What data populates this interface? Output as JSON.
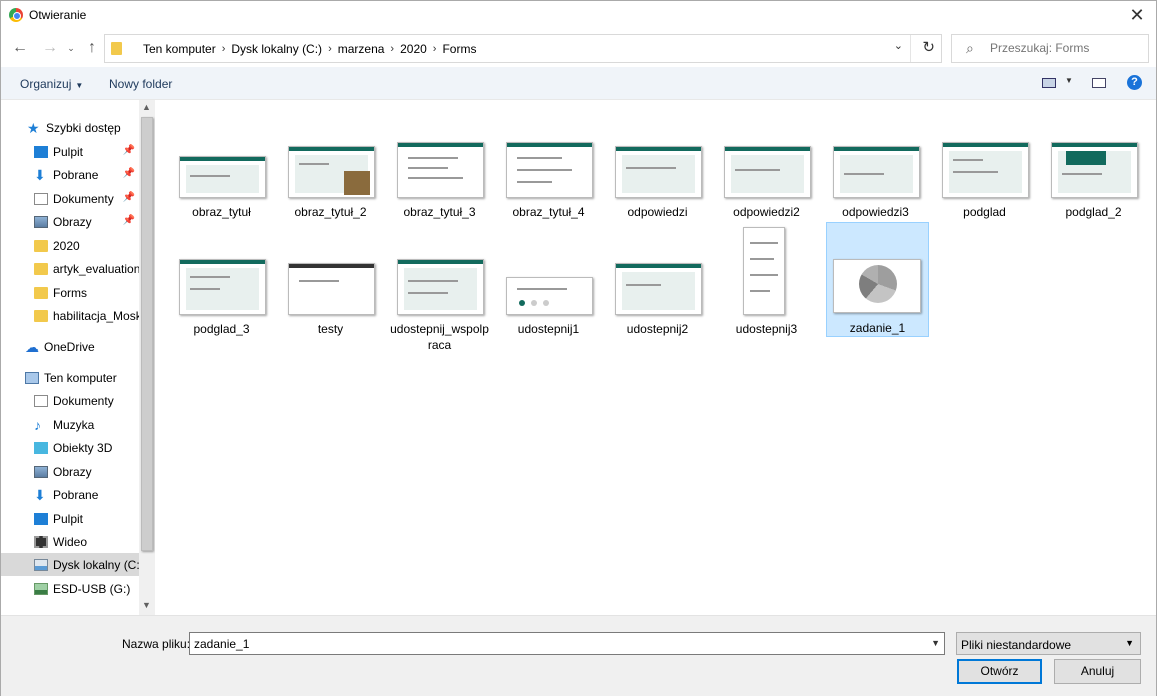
{
  "window": {
    "title": "Otwieranie"
  },
  "nav": {
    "breadcrumbs": [
      "Ten komputer",
      "Dysk lokalny (C:)",
      "marzena",
      "2020",
      "Forms"
    ],
    "search_placeholder": "Przeszukaj: Forms"
  },
  "toolbar": {
    "organize": "Organizuj",
    "new_folder": "Nowy folder"
  },
  "sidebar": {
    "items": [
      {
        "label": "Szybki dostęp",
        "icon": "star-icon"
      },
      {
        "label": "Pulpit",
        "icon": "desktop-icon",
        "pinned": true
      },
      {
        "label": "Pobrane",
        "icon": "download-icon",
        "pinned": true
      },
      {
        "label": "Dokumenty",
        "icon": "documents-icon",
        "pinned": true
      },
      {
        "label": "Obrazy",
        "icon": "pictures-icon",
        "pinned": true
      },
      {
        "label": "2020",
        "icon": "folder-icon"
      },
      {
        "label": "artyk_evaluation",
        "icon": "folder-icon"
      },
      {
        "label": "Forms",
        "icon": "folder-icon"
      },
      {
        "label": "habilitacja_Moskwa",
        "icon": "folder-icon"
      },
      {
        "label": "OneDrive",
        "icon": "cloud-icon"
      },
      {
        "label": "Ten komputer",
        "icon": "computer-icon"
      },
      {
        "label": "Dokumenty",
        "icon": "documents-icon"
      },
      {
        "label": "Muzyka",
        "icon": "music-icon"
      },
      {
        "label": "Obiekty 3D",
        "icon": "cube-icon"
      },
      {
        "label": "Obrazy",
        "icon": "pictures-icon"
      },
      {
        "label": "Pobrane",
        "icon": "download-icon"
      },
      {
        "label": "Pulpit",
        "icon": "desktop-icon"
      },
      {
        "label": "Wideo",
        "icon": "video-icon"
      },
      {
        "label": "Dysk lokalny (C:)",
        "icon": "drive-icon",
        "selected": true
      },
      {
        "label": "ESD-USB (G:)",
        "icon": "usb-drive-icon"
      }
    ]
  },
  "files": [
    {
      "name": "obraz_tytuł"
    },
    {
      "name": "obraz_tytuł_2"
    },
    {
      "name": "obraz_tytuł_3"
    },
    {
      "name": "obraz_tytuł_4"
    },
    {
      "name": "odpowiedzi"
    },
    {
      "name": "odpowiedzi2"
    },
    {
      "name": "odpowiedzi3"
    },
    {
      "name": "podglad"
    },
    {
      "name": "podglad_2"
    },
    {
      "name": "podglad_3"
    },
    {
      "name": "testy"
    },
    {
      "name": "udostepnij_wspolpraca"
    },
    {
      "name": "udostepnij1"
    },
    {
      "name": "udostepnij2"
    },
    {
      "name": "udostepnij3"
    },
    {
      "name": "zadanie_1",
      "selected": true
    }
  ],
  "bottom": {
    "filename_label": "Nazwa pliku:",
    "filename_value": "zadanie_1",
    "filetype": "Pliki niestandardowe",
    "open_button": "Otwórz",
    "cancel_button": "Anuluj"
  },
  "colors": {
    "accent": "#0078d7",
    "selection": "#cce8ff",
    "forms_green": "#126a5d"
  }
}
